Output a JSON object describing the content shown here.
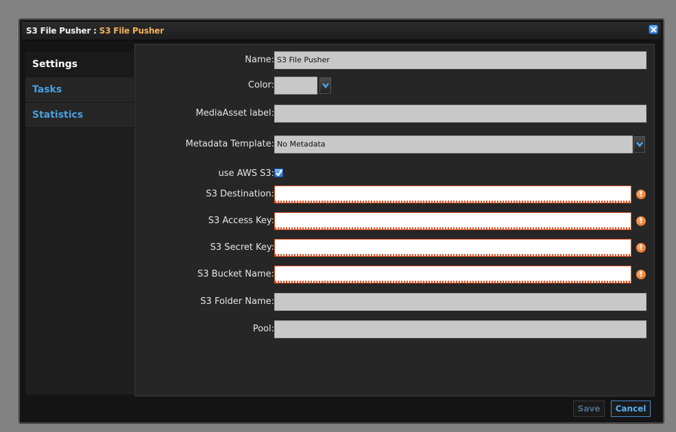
{
  "title": {
    "prefix": "S3 File Pusher : ",
    "name": "S3 File Pusher"
  },
  "sidebar": {
    "items": [
      {
        "label": "Settings",
        "active": true
      },
      {
        "label": "Tasks",
        "active": false
      },
      {
        "label": "Statistics",
        "active": false
      }
    ]
  },
  "form": {
    "name_label": "Name:",
    "name_value": "S3 File Pusher",
    "color_label": "Color:",
    "mediaasset_label": "MediaAsset label:",
    "mediaasset_value": "",
    "metadata_label": "Metadata Template:",
    "metadata_value": "No Metadata",
    "aws_label": "use AWS S3:",
    "aws_checked": true,
    "s3_destination_label": "S3 Destination:",
    "s3_access_key_label": "S3 Access Key:",
    "s3_secret_key_label": "S3 Secret Key:",
    "s3_bucket_name_label": "S3 Bucket Name:",
    "s3_folder_name_label": "S3 Folder Name:",
    "pool_label": "Pool:"
  },
  "buttons": {
    "save": "Save",
    "cancel": "Cancel"
  },
  "icons": {
    "close": "close-icon",
    "dropdown": "chevron-down-icon",
    "error": "warning-icon",
    "check": "check-icon"
  },
  "colors": {
    "accent": "#f4b25a",
    "link": "#4aa0e0",
    "error": "#e05020"
  }
}
